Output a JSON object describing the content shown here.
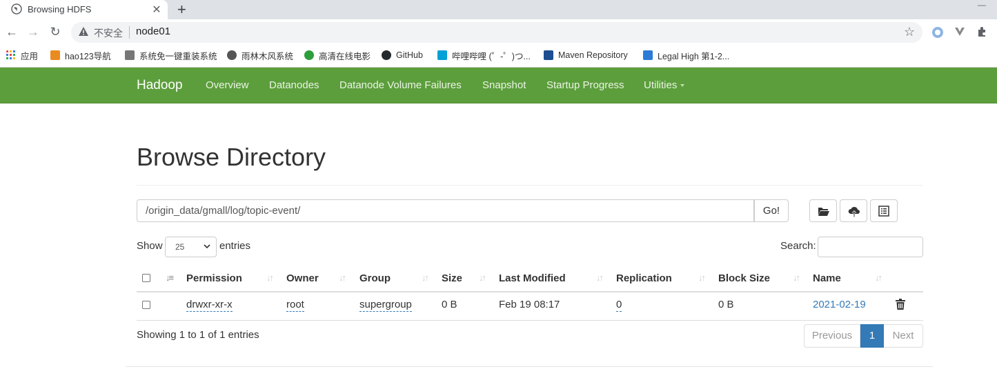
{
  "browser": {
    "tab_title": "Browsing HDFS",
    "tab_close": "✕",
    "new_tab": "+",
    "back": "←",
    "forward": "→",
    "reload": "↻",
    "insecure_label": "不安全",
    "url": "node01",
    "star": "☆"
  },
  "bookmarks": [
    {
      "label": "应用",
      "icon": "apps-grid-icon",
      "color": "#e8453c"
    },
    {
      "label": "hao123导航",
      "icon": "hao123-icon",
      "color": "#e98b1f"
    },
    {
      "label": "系统免一键重装系统",
      "icon": "tool-icon",
      "color": "#555555"
    },
    {
      "label": "雨林木风系统",
      "icon": "globe-icon",
      "color": "#555555"
    },
    {
      "label": "高清在线电影",
      "icon": "movie-icon",
      "color": "#2e9e3b"
    },
    {
      "label": "GitHub",
      "icon": "github-icon",
      "color": "#24292e"
    },
    {
      "label": "哔哩哔哩 (゜-゜)つ...",
      "icon": "bilibili-icon",
      "color": "#00a1d6"
    },
    {
      "label": "Maven Repository",
      "icon": "maven-icon",
      "color": "#1d4e91"
    },
    {
      "label": "Legal High 第1-2...",
      "icon": "dd-icon",
      "color": "#2d7bd6"
    }
  ],
  "navbar": {
    "brand": "Hadoop",
    "links": [
      "Overview",
      "Datanodes",
      "Datanode Volume Failures",
      "Snapshot",
      "Startup Progress",
      "Utilities"
    ],
    "bg_color": "#5c9e3c"
  },
  "page": {
    "title": "Browse Directory",
    "path": "/origin_data/gmall/log/topic-event/",
    "go_label": "Go!",
    "show_label": "Show",
    "page_length": "25",
    "entries_label": "entries",
    "search_label": "Search:"
  },
  "table": {
    "columns": [
      "Permission",
      "Owner",
      "Group",
      "Size",
      "Last Modified",
      "Replication",
      "Block Size",
      "Name"
    ],
    "rows": [
      {
        "permission": "drwxr-xr-x",
        "owner": "root",
        "group": "supergroup",
        "size": "0 B",
        "last_modified": "Feb 19 08:17",
        "replication": "0",
        "block_size": "0 B",
        "name": "2021-02-19"
      }
    ]
  },
  "footer": {
    "info": "Showing 1 to 1 of 1 entries",
    "previous": "Previous",
    "current_page": "1",
    "next": "Next"
  }
}
